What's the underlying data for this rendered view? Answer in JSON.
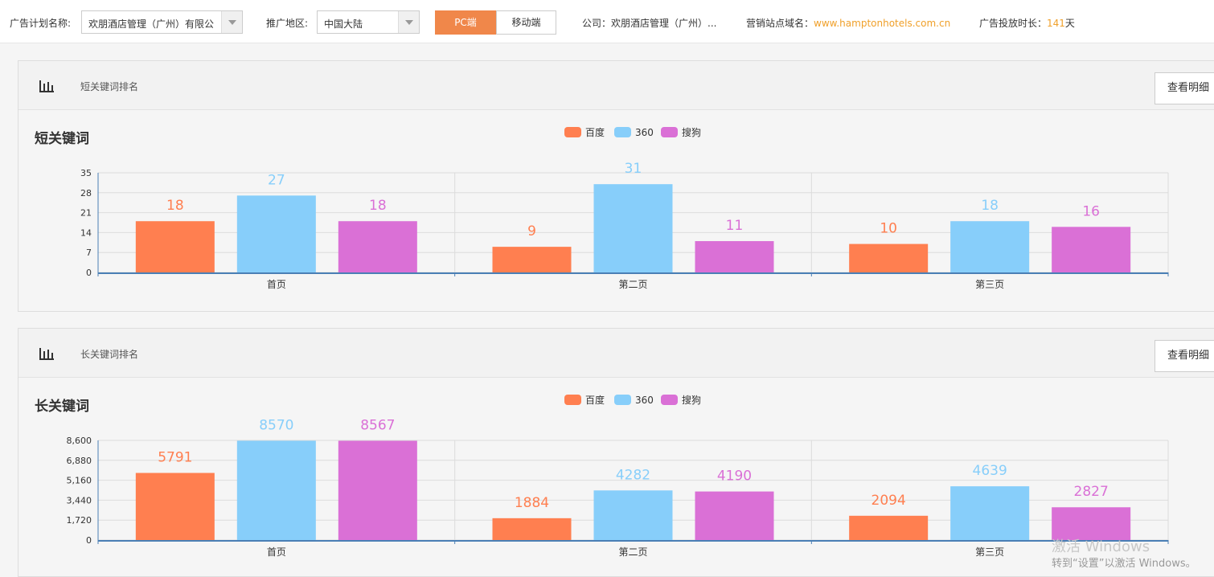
{
  "topbar": {
    "plan_label": "广告计划名称:",
    "plan_value": "欢朋酒店管理（广州）有限公",
    "region_label": "推广地区:",
    "region_value": "中国大陆",
    "tab_pc": "PC端",
    "tab_mobile": "移动端",
    "company": "公司：欢朋酒店管理（广州）...",
    "site_label": "营销站点域名：",
    "site_value": "www.hamptonhotels.com.cn",
    "duration_label": "广告投放时长：",
    "duration_value": "141",
    "duration_unit": "天"
  },
  "panels": [
    {
      "header": "短关键词排名",
      "detail_button": "查看明细",
      "chart_title": "短关键词"
    },
    {
      "header": "长关键词排名",
      "detail_button": "查看明细",
      "chart_title": "长关键词"
    }
  ],
  "chart_data": [
    {
      "type": "bar",
      "title": "短关键词",
      "categories": [
        "首页",
        "第二页",
        "第三页"
      ],
      "series": [
        {
          "name": "百度",
          "color": "#ff7f50",
          "values": [
            18,
            9,
            10
          ]
        },
        {
          "name": "360",
          "color": "#87cefa",
          "values": [
            27,
            31,
            18
          ]
        },
        {
          "name": "搜狗",
          "color": "#da70d6",
          "values": [
            18,
            11,
            16
          ]
        }
      ],
      "yticks": [
        "0",
        "7",
        "14",
        "21",
        "28",
        "35"
      ],
      "ylim": [
        0,
        35
      ],
      "legend": "top-center",
      "grid": true
    },
    {
      "type": "bar",
      "title": "长关键词",
      "categories": [
        "首页",
        "第二页",
        "第三页"
      ],
      "series": [
        {
          "name": "百度",
          "color": "#ff7f50",
          "values": [
            5791,
            1884,
            2094
          ]
        },
        {
          "name": "360",
          "color": "#87cefa",
          "values": [
            8570,
            4282,
            4639
          ]
        },
        {
          "name": "搜狗",
          "color": "#da70d6",
          "values": [
            8567,
            4190,
            2827
          ]
        }
      ],
      "yticks": [
        "0",
        "1,720",
        "3,440",
        "5,160",
        "6,880",
        "8,600"
      ],
      "ylim": [
        0,
        8600
      ],
      "legend": "top-center",
      "grid": true
    }
  ],
  "watermark": {
    "line1": "激活 Windows",
    "line2": "转到“设置”以激活 Windows。"
  }
}
